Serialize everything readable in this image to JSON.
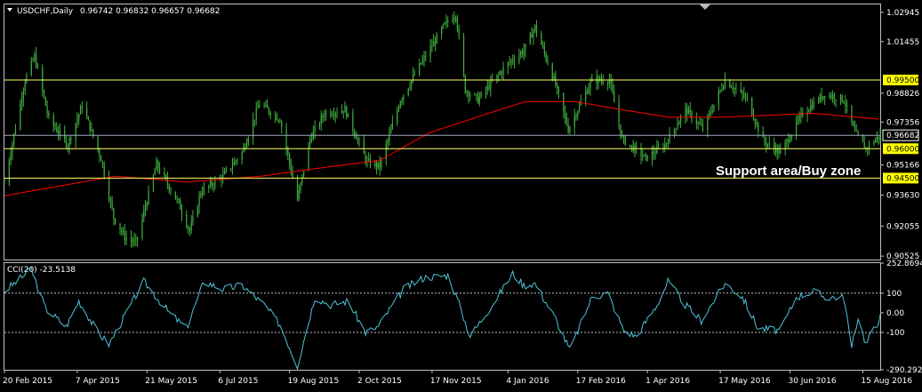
{
  "window": {
    "symbol_header": "USDCHF,Daily",
    "ohlc_header": "0.96742 0.96832 0.96657 0.96682"
  },
  "colors": {
    "background": "#000000",
    "frame": "#c0c0c0",
    "candles": "#3fae3f",
    "moving_average": "#ff0000",
    "level_lines": "#ffff66",
    "price_line": "#a0a8c0",
    "cci_line": "#4fc3d8",
    "cci_levels": "#c0c0c0",
    "text": "#ffffff",
    "label_highlight": "#ffff00"
  },
  "chart_data": [
    {
      "type": "candlestick",
      "title": "USDCHF,Daily",
      "ylim": [
        0.9035,
        1.0335
      ],
      "yticks": [
        "1.02945",
        "1.01455",
        "0.98826",
        "0.97356",
        "0.95166",
        "0.93630",
        "0.92055",
        "0.90525"
      ],
      "xticks": [
        "20 Feb 2015",
        "7 Apr 2015",
        "21 May 2015",
        "6 Jul 2015",
        "19 Aug 2015",
        "2 Oct 2015",
        "17 Nov 2015",
        "4 Jan 2016",
        "17 Feb 2016",
        "1 Apr 2016",
        "17 May 2016",
        "30 Jun 2016",
        "15 Aug 2016"
      ],
      "xrange": [
        "2015-02-20",
        "2016-08-26"
      ],
      "grid": false,
      "horizontal_levels": [
        {
          "label": "0.99500",
          "value": 0.995,
          "highlighted": true
        },
        {
          "label": "0.96000",
          "value": 0.96,
          "highlighted": true
        },
        {
          "label": "0.94500",
          "value": 0.945,
          "highlighted": true
        }
      ],
      "current_price": {
        "label": "0.96682",
        "value": 0.96682
      },
      "annotation": "Support area/Buy zone",
      "price_anchors": [
        [
          "2015-02-20",
          0.943
        ],
        [
          "2015-03-05",
          0.995
        ],
        [
          "2015-03-11",
          1.007
        ],
        [
          "2015-03-20",
          0.975
        ],
        [
          "2015-04-01",
          0.962
        ],
        [
          "2015-04-10",
          0.982
        ],
        [
          "2015-04-22",
          0.955
        ],
        [
          "2015-04-30",
          0.925
        ],
        [
          "2015-05-07",
          0.915
        ],
        [
          "2015-05-14",
          0.912
        ],
        [
          "2015-05-27",
          0.952
        ],
        [
          "2015-06-10",
          0.932
        ],
        [
          "2015-06-17",
          0.918
        ],
        [
          "2015-06-24",
          0.938
        ],
        [
          "2015-07-08",
          0.946
        ],
        [
          "2015-07-20",
          0.958
        ],
        [
          "2015-07-31",
          0.983
        ],
        [
          "2015-08-13",
          0.975
        ],
        [
          "2015-08-24",
          0.934
        ],
        [
          "2015-09-01",
          0.965
        ],
        [
          "2015-09-10",
          0.978
        ],
        [
          "2015-09-23",
          0.98
        ],
        [
          "2015-10-07",
          0.953
        ],
        [
          "2015-10-15",
          0.951
        ],
        [
          "2015-10-28",
          0.985
        ],
        [
          "2015-11-09",
          1.002
        ],
        [
          "2015-11-25",
          1.023
        ],
        [
          "2015-12-02",
          1.029
        ],
        [
          "2015-12-08",
          0.99
        ],
        [
          "2015-12-16",
          0.985
        ],
        [
          "2015-12-24",
          0.993
        ],
        [
          "2016-01-06",
          1.005
        ],
        [
          "2016-01-14",
          1.01
        ],
        [
          "2016-01-21",
          1.022
        ],
        [
          "2016-02-02",
          0.995
        ],
        [
          "2016-02-11",
          0.97
        ],
        [
          "2016-02-26",
          0.995
        ],
        [
          "2016-03-08",
          0.995
        ],
        [
          "2016-03-16",
          0.965
        ],
        [
          "2016-03-31",
          0.955
        ],
        [
          "2016-04-12",
          0.962
        ],
        [
          "2016-04-25",
          0.98
        ],
        [
          "2016-05-06",
          0.97
        ],
        [
          "2016-05-20",
          0.995
        ],
        [
          "2016-06-03",
          0.985
        ],
        [
          "2016-06-13",
          0.964
        ],
        [
          "2016-06-24",
          0.958
        ],
        [
          "2016-07-08",
          0.978
        ],
        [
          "2016-07-22",
          0.988
        ],
        [
          "2016-08-03",
          0.985
        ],
        [
          "2016-08-10",
          0.968
        ],
        [
          "2016-08-17",
          0.96
        ],
        [
          "2016-08-26",
          0.967
        ]
      ],
      "ma_anchors": [
        [
          "2015-02-20",
          0.936
        ],
        [
          "2015-03-20",
          0.94
        ],
        [
          "2015-05-01",
          0.946
        ],
        [
          "2015-06-15",
          0.943
        ],
        [
          "2015-08-01",
          0.946
        ],
        [
          "2015-09-15",
          0.951
        ],
        [
          "2015-10-15",
          0.954
        ],
        [
          "2015-11-15",
          0.968
        ],
        [
          "2015-12-15",
          0.976
        ],
        [
          "2016-01-15",
          0.984
        ],
        [
          "2016-02-15",
          0.984
        ],
        [
          "2016-03-15",
          0.98
        ],
        [
          "2016-04-15",
          0.976
        ],
        [
          "2016-05-15",
          0.976
        ],
        [
          "2016-06-15",
          0.977
        ],
        [
          "2016-07-15",
          0.978
        ],
        [
          "2016-08-26",
          0.975
        ]
      ]
    },
    {
      "type": "line",
      "title": "CCI(20) -23.5138",
      "ylim": [
        -290.2926,
        252.8694
      ],
      "yticks": [
        "252.8694",
        "100",
        "0.00",
        "-100",
        "-290.2926"
      ],
      "levels": [
        100,
        -100
      ],
      "cci_anchors": [
        [
          "2015-02-20",
          110
        ],
        [
          "2015-03-09",
          220
        ],
        [
          "2015-03-18",
          20
        ],
        [
          "2015-03-31",
          -70
        ],
        [
          "2015-04-08",
          60
        ],
        [
          "2015-04-20",
          -100
        ],
        [
          "2015-04-27",
          -160
        ],
        [
          "2015-05-08",
          0
        ],
        [
          "2015-05-19",
          160
        ],
        [
          "2015-06-04",
          0
        ],
        [
          "2015-06-15",
          -80
        ],
        [
          "2015-06-26",
          160
        ],
        [
          "2015-07-08",
          120
        ],
        [
          "2015-07-20",
          140
        ],
        [
          "2015-08-03",
          40
        ],
        [
          "2015-08-13",
          -60
        ],
        [
          "2015-08-24",
          -270
        ],
        [
          "2015-09-04",
          80
        ],
        [
          "2015-09-14",
          40
        ],
        [
          "2015-09-25",
          60
        ],
        [
          "2015-10-06",
          -100
        ],
        [
          "2015-10-14",
          -70
        ],
        [
          "2015-10-30",
          120
        ],
        [
          "2015-11-12",
          180
        ],
        [
          "2015-11-27",
          190
        ],
        [
          "2015-12-03",
          70
        ],
        [
          "2015-12-11",
          -120
        ],
        [
          "2015-12-25",
          40
        ],
        [
          "2016-01-07",
          200
        ],
        [
          "2016-01-14",
          140
        ],
        [
          "2016-01-21",
          150
        ],
        [
          "2016-02-03",
          -30
        ],
        [
          "2016-02-12",
          -190
        ],
        [
          "2016-02-26",
          80
        ],
        [
          "2016-03-07",
          100
        ],
        [
          "2016-03-17",
          -90
        ],
        [
          "2016-03-25",
          -120
        ],
        [
          "2016-04-07",
          40
        ],
        [
          "2016-04-14",
          160
        ],
        [
          "2016-04-25",
          40
        ],
        [
          "2016-05-05",
          -40
        ],
        [
          "2016-05-20",
          150
        ],
        [
          "2016-05-31",
          80
        ],
        [
          "2016-06-10",
          -80
        ],
        [
          "2016-06-24",
          -90
        ],
        [
          "2016-07-04",
          80
        ],
        [
          "2016-07-15",
          110
        ],
        [
          "2016-07-22",
          80
        ],
        [
          "2016-08-03",
          80
        ],
        [
          "2016-08-08",
          -180
        ],
        [
          "2016-08-12",
          -20
        ],
        [
          "2016-08-17",
          -160
        ],
        [
          "2016-08-26",
          -23.5
        ]
      ]
    }
  ]
}
